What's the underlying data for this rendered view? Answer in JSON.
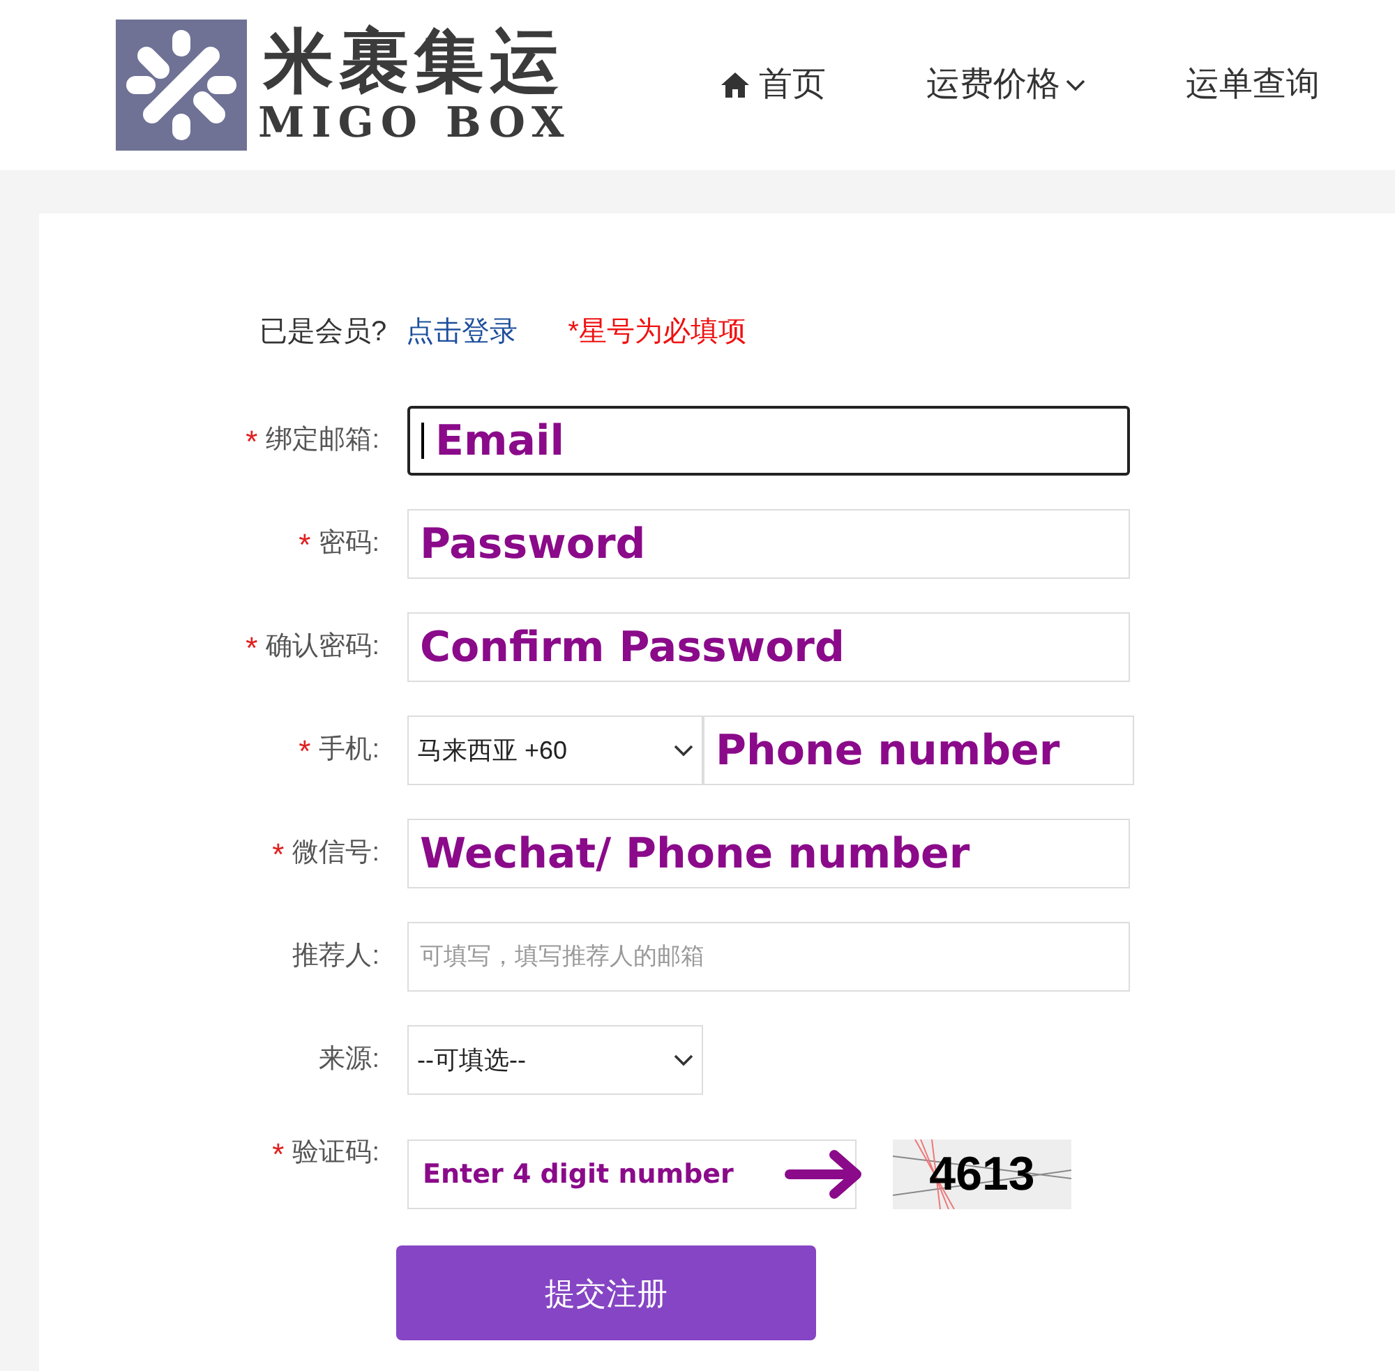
{
  "header": {
    "logo": {
      "title": "米裹集运",
      "subtitle": "MIGO BOX"
    },
    "nav": [
      {
        "label": "首页",
        "kind": "home"
      },
      {
        "label": "运费价格",
        "kind": "dropdown"
      },
      {
        "label": "运单查询",
        "kind": "plain"
      }
    ]
  },
  "form": {
    "intro": {
      "prompt": "已是会员?",
      "link": "点击登录",
      "note": "*星号为必填项"
    },
    "fields": [
      {
        "mark": "*",
        "label": "绑定邮箱:",
        "kind": "text",
        "value": "Email",
        "focused": true
      },
      {
        "mark": "*",
        "label": "密码:",
        "kind": "text",
        "value": "Password",
        "focused": false
      },
      {
        "mark": "*",
        "label": "确认密码:",
        "kind": "text",
        "value": "Confirm Password",
        "focused": false
      },
      {
        "mark": "*",
        "label": "手机:",
        "kind": "phone",
        "country": "马来西亚 +60",
        "value": "Phone number",
        "focused": false
      },
      {
        "mark": "*",
        "label": "微信号:",
        "kind": "text",
        "value": "Wechat/ Phone number",
        "focused": false
      },
      {
        "label": "推荐人:",
        "kind": "text",
        "placeholder": "可填写，填写推荐人的邮箱",
        "focused": false
      },
      {
        "label": "来源:",
        "kind": "select",
        "value": "--可填选--"
      },
      {
        "mark": "*",
        "label": "验证码:",
        "kind": "captcha",
        "value": "Enter 4 digit number",
        "captcha": "4613"
      }
    ],
    "submit": "提交注册"
  }
}
